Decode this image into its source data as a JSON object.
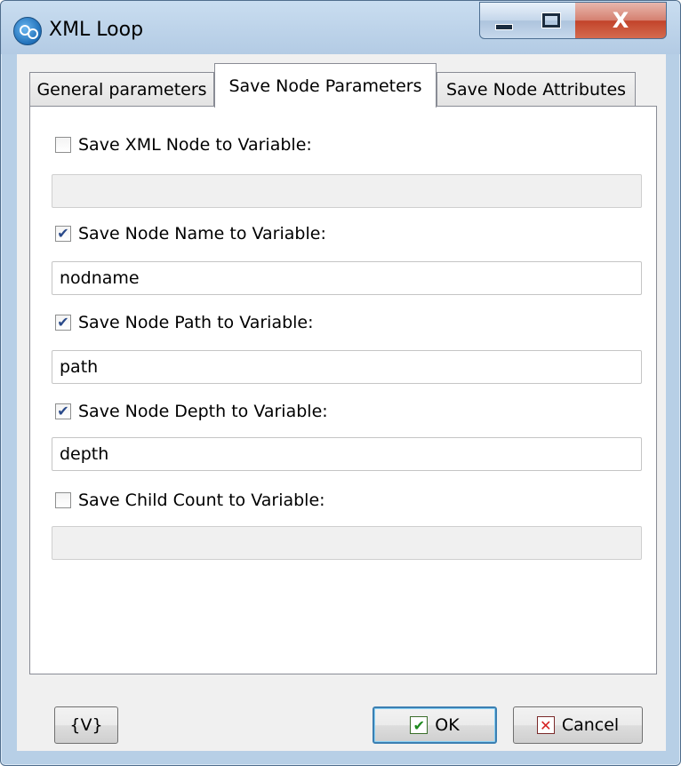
{
  "window": {
    "title": "XML Loop",
    "controls": {
      "minimize": "minimize",
      "maximize": "maximize",
      "close": "X"
    }
  },
  "tabs": [
    {
      "label": "General parameters",
      "active": false
    },
    {
      "label": "Save Node Parameters",
      "active": true
    },
    {
      "label": "Save Node Attributes",
      "active": false
    }
  ],
  "options": [
    {
      "label": "Save XML Node to Variable:",
      "checked": false,
      "value": "",
      "enabled": false
    },
    {
      "label": "Save Node Name to Variable:",
      "checked": true,
      "value": "nodname",
      "enabled": true
    },
    {
      "label": "Save Node Path to Variable:",
      "checked": true,
      "value": "path",
      "enabled": true
    },
    {
      "label": "Save Node Depth to Variable:",
      "checked": true,
      "value": "depth",
      "enabled": true
    },
    {
      "label": "Save Child Count to Variable:",
      "checked": false,
      "value": "",
      "enabled": false
    }
  ],
  "buttons": {
    "variables": "{V}",
    "ok": "OK",
    "cancel": "Cancel"
  },
  "check_glyph": "✔",
  "cancel_glyph": "✕"
}
